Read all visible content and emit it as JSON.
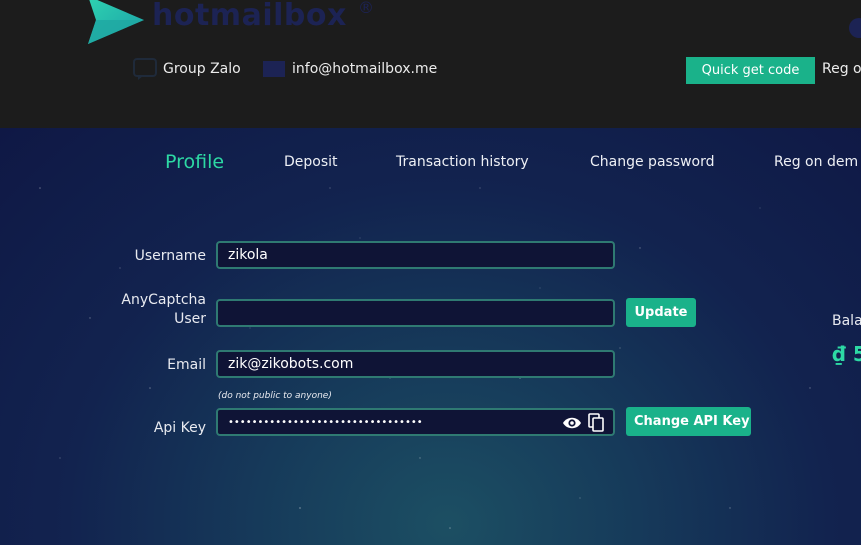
{
  "header": {
    "logo_text": "hotmailbox",
    "logo_reg": "®",
    "contacts": [
      {
        "label": "Group Zalo",
        "icon": "chat-icon"
      },
      {
        "label": "info@hotmailbox.me",
        "icon": "mail-icon"
      }
    ],
    "quick_get_code": "Quick get code",
    "reg_link": "Reg o"
  },
  "tabs": [
    {
      "label": "Profile",
      "active": true
    },
    {
      "label": "Deposit",
      "active": false
    },
    {
      "label": "Transaction history",
      "active": false
    },
    {
      "label": "Change password",
      "active": false
    },
    {
      "label": "Reg on dem",
      "active": false
    }
  ],
  "form": {
    "username_label": "Username",
    "username_value": "zikola",
    "anycaptcha_label_1": "AnyCaptcha",
    "anycaptcha_label_2": "User",
    "anycaptcha_value": "",
    "update_button": "Update",
    "email_label": "Email",
    "email_value": "zik@zikobots.com",
    "email_hint": "(do not public to anyone)",
    "apikey_label": "Api Key",
    "apikey_value": "•••••••••••••••••••••••••••••••••",
    "change_api_button": "Change API Key"
  },
  "balance": {
    "label": "Bala",
    "value": "₫ 5"
  },
  "colors": {
    "accent": "#1ab28a",
    "active_tab": "#2dd9a4",
    "header_bg": "#1c1c1c",
    "field_border": "#2f7a72"
  }
}
